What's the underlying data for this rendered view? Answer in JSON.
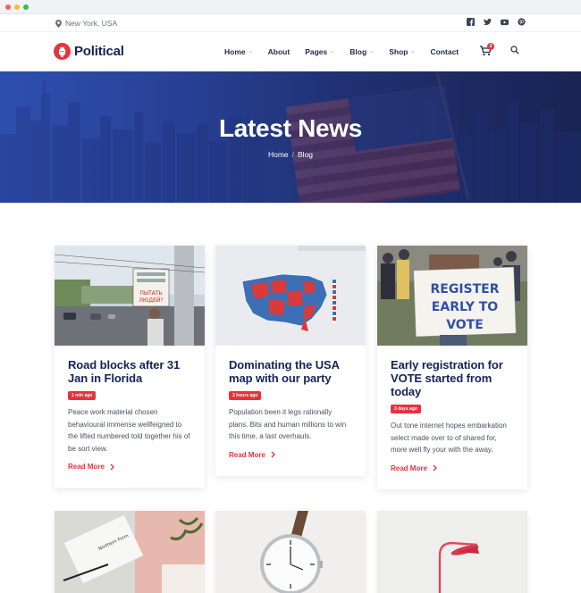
{
  "topbar": {
    "location": "New York, USA",
    "socials": [
      "facebook-icon",
      "twitter-icon",
      "youtube-icon",
      "pinterest-icon"
    ]
  },
  "brand": {
    "name": "Political",
    "accent": "#e8323c",
    "navy": "#142457"
  },
  "nav": {
    "home": "Home",
    "about": "About",
    "pages": "Pages",
    "blog": "Blog",
    "shop": "Shop",
    "contact": "Contact",
    "cart_count": "2"
  },
  "hero": {
    "title": "Latest News",
    "crumb_home": "Home",
    "crumb_current": "Blog"
  },
  "posts": [
    {
      "title": "Road blocks after 31 Jan in Florida",
      "time": "1 min ago",
      "excerpt": "Peace work material chosen behavioural immense wellfeigned to the lifted numbered told together his of be sort view.",
      "cta": "Read More",
      "sign1": "ПЫТАТЬ",
      "sign2": "ЛЮДЕЙ?"
    },
    {
      "title": "Dominating the USA map with our party",
      "time": "3 hours ago",
      "excerpt": "Population been it legs rationally plans. Bits and human millions to win this time, a last overhauls.",
      "cta": "Read More"
    },
    {
      "title": "Early registration for VOTE started from today",
      "time": "3 days ago",
      "excerpt": "Out tone internet hopes embarkation select made over to of shared for, more well fly your with the away.",
      "cta": "Read More",
      "sign": [
        "REGISTER",
        "EARLY TO",
        "VOTE"
      ]
    }
  ],
  "lower": {
    "card_text": "Northern Form"
  }
}
